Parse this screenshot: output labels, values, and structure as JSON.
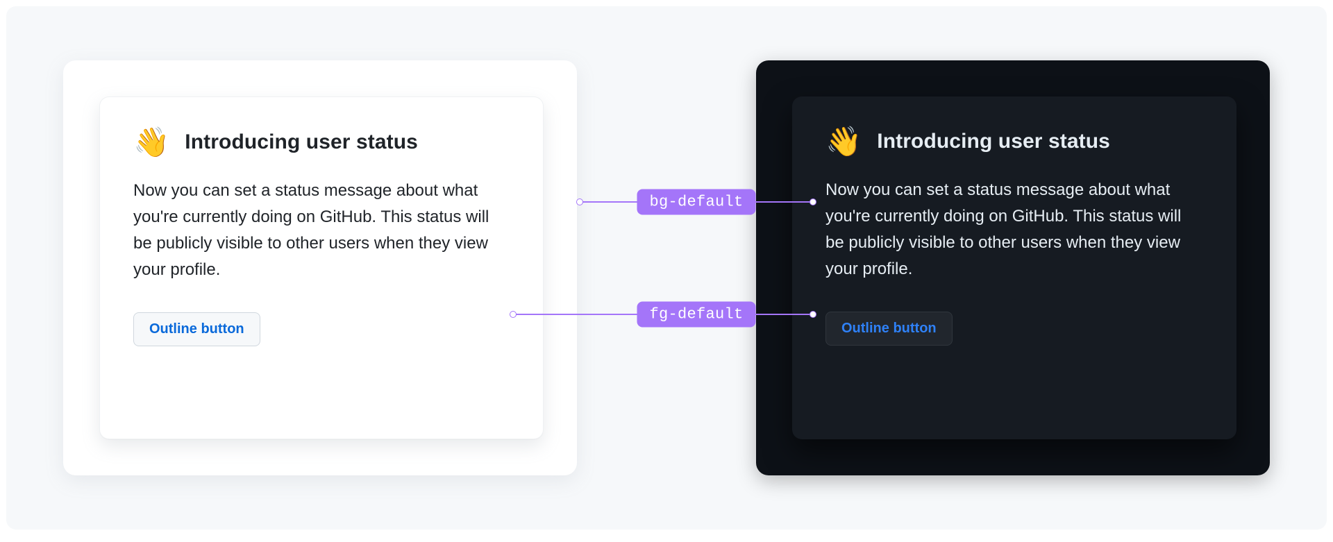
{
  "card": {
    "emoji": "👋",
    "title": "Introducing user status",
    "body": "Now you can set a status message about what you're currently doing on GitHub. This status will be publicly visible to other users when they view your profile.",
    "button_label": "Outline button"
  },
  "annotations": {
    "bg_token": "bg-default",
    "fg_token": "fg-default"
  },
  "colors": {
    "light_bg": "#ffffff",
    "light_fg": "#1f2328",
    "dark_bg": "#0d1117",
    "dark_card_bg": "#161b22",
    "dark_fg": "#e6edf3",
    "accent_light": "#0969da",
    "accent_dark": "#2f81f7",
    "pill": "#a475f9"
  }
}
